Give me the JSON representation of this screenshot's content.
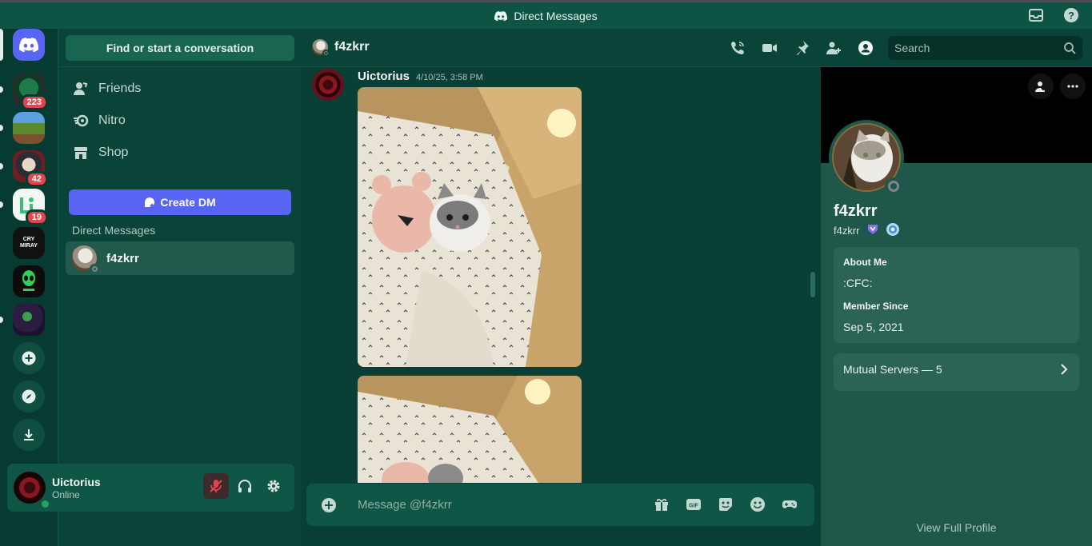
{
  "window": {
    "title": "Direct Messages"
  },
  "servers": [
    {
      "name": "server-1",
      "badge": "223"
    },
    {
      "name": "server-triocraft",
      "badge": ""
    },
    {
      "name": "server-3",
      "badge": "42"
    },
    {
      "name": "server-4",
      "badge": "19"
    },
    {
      "name": "server-cry-miray",
      "badge": "",
      "label": "CRY MIRAY"
    },
    {
      "name": "server-6",
      "badge": ""
    },
    {
      "name": "server-7",
      "badge": ""
    }
  ],
  "sidebar": {
    "find_label": "Find or start a conversation",
    "nav": [
      {
        "label": "Friends",
        "icon": "friends-icon"
      },
      {
        "label": "Nitro",
        "icon": "nitro-icon"
      },
      {
        "label": "Shop",
        "icon": "shop-icon"
      }
    ],
    "create_dm_label": "Create DM",
    "dm_header": "Direct Messages",
    "dms": [
      {
        "name": "f4zkrr",
        "status": "offline"
      }
    ]
  },
  "user_panel": {
    "name": "Uictorius",
    "status": "Online"
  },
  "chat": {
    "recipient": "f4zkrr",
    "search_placeholder": "Search",
    "composer_placeholder": "Message @f4zkrr",
    "messages": [
      {
        "author": "Uictorius",
        "timestamp": "4/10/25, 3:58 PM",
        "attachments": 2
      }
    ]
  },
  "profile": {
    "display_name": "f4zkrr",
    "username": "f4zkrr",
    "about_label": "About Me",
    "about_text": ":CFC:",
    "member_since_label": "Member Since",
    "member_since": "Sep 5, 2021",
    "mutual_servers": "Mutual Servers — 5",
    "view_full": "View Full Profile"
  },
  "colors": {
    "accent": "#5865f2",
    "theme_bg": "#0a4438",
    "badge_red": "#e8424d",
    "online": "#23a55a"
  }
}
